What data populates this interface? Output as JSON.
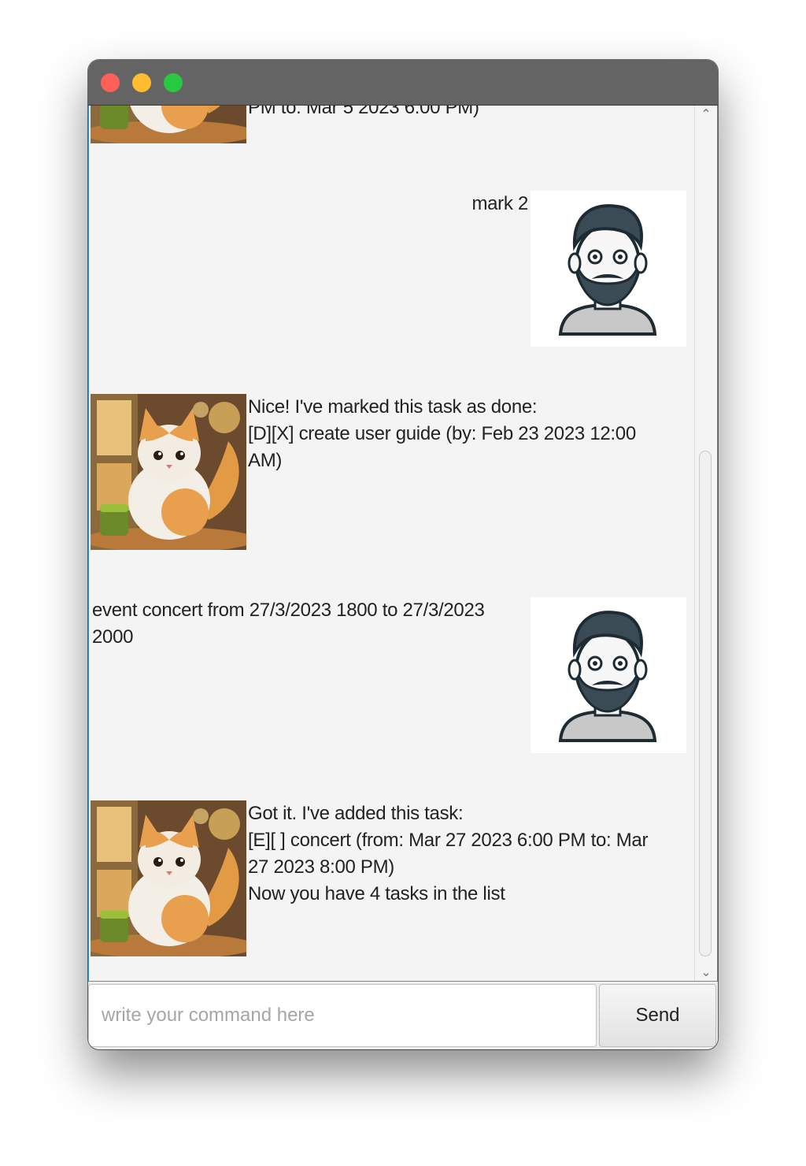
{
  "window": {
    "controls": [
      "close",
      "minimize",
      "maximize"
    ]
  },
  "dialog": [
    {
      "speaker": "bot",
      "avatar": "cat-avatar-icon",
      "lines": [
        "PM to: Mar 5 2023 6:00 PM)"
      ]
    },
    {
      "speaker": "user",
      "avatar": "bearded-man-avatar-icon",
      "lines": [
        "mark 2"
      ]
    },
    {
      "speaker": "bot",
      "avatar": "cat-avatar-icon",
      "lines": [
        "Nice! I've marked this task as done:",
        "[D][X] create user guide (by: Feb 23 2023 12:00",
        "AM)"
      ]
    },
    {
      "speaker": "user",
      "avatar": "bearded-man-avatar-icon",
      "lines": [
        "event concert from 27/3/2023 1800 to 27/3/2023",
        "2000"
      ]
    },
    {
      "speaker": "bot",
      "avatar": "cat-avatar-icon",
      "lines": [
        "Got it. I've added this task:",
        "[E][ ] concert (from: Mar 27 2023 6:00 PM to: Mar",
        "27 2023 8:00 PM)",
        "Now you have 4 tasks in the list"
      ]
    }
  ],
  "input": {
    "placeholder": "write your command here",
    "value": ""
  },
  "send_label": "Send",
  "colors": {
    "titlebar": "#646464",
    "background": "#f4f4f4",
    "focus": "#3b93d4"
  }
}
